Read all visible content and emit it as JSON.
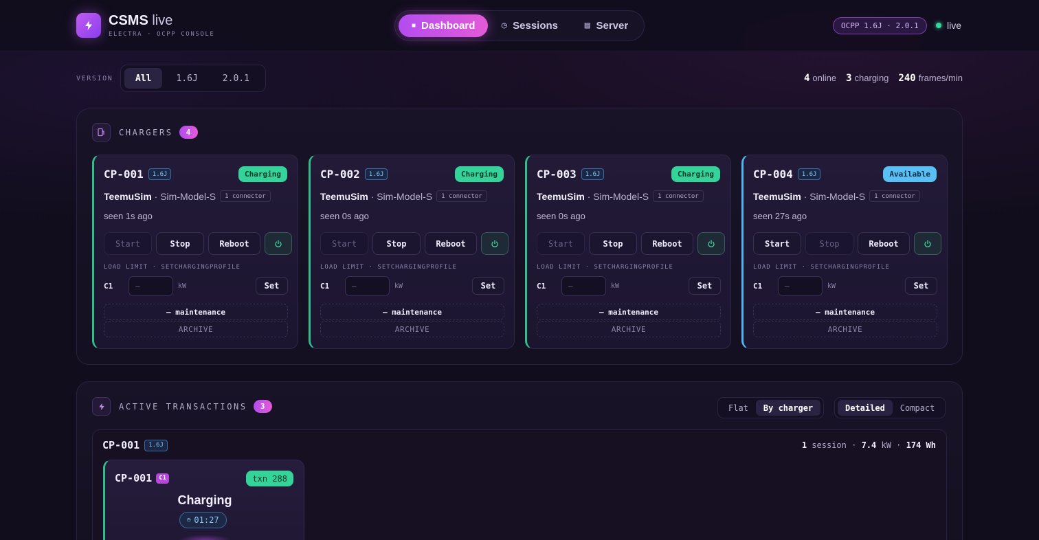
{
  "brand": {
    "title": "CSMS",
    "title_suffix": "live",
    "subtitle": "ELECTRA · OCPP CONSOLE"
  },
  "nav": [
    {
      "label": "Dashboard",
      "icon": "grid-icon",
      "active": true
    },
    {
      "label": "Sessions",
      "icon": "clock-icon",
      "active": false
    },
    {
      "label": "Server",
      "icon": "server-icon",
      "active": false
    }
  ],
  "protocol_badge": "OCPP 1.6J · 2.0.1",
  "live_label": "live",
  "filter": {
    "label": "VERSION",
    "options": [
      "All",
      "1.6J",
      "2.0.1"
    ],
    "selected": "All"
  },
  "stats": [
    {
      "value": "4",
      "label": "online"
    },
    {
      "value": "3",
      "label": "charging"
    },
    {
      "value": "240",
      "label": "frames/min"
    }
  ],
  "chargers_panel": {
    "title": "CHARGERS",
    "count": "4"
  },
  "chargers": [
    {
      "id": "CP-001",
      "version": "1.6J",
      "status": "Charging",
      "vendor": "TeemuSim",
      "model": "Sim-Model-S",
      "connectors": "1 connector",
      "seen": "seen 1s ago",
      "buttons": {
        "start": "Start",
        "stop": "Stop",
        "reboot": "Reboot"
      },
      "start_enabled": false,
      "stop_enabled": true,
      "load_label": "LOAD LIMIT · SETCHARGINGPROFILE",
      "connector": "C1",
      "kw_placeholder": "—",
      "kw_unit": "kW",
      "set": "Set",
      "maintenance": "– maintenance",
      "archive": "ARCHIVE"
    },
    {
      "id": "CP-002",
      "version": "1.6J",
      "status": "Charging",
      "vendor": "TeemuSim",
      "model": "Sim-Model-S",
      "connectors": "1 connector",
      "seen": "seen 0s ago",
      "buttons": {
        "start": "Start",
        "stop": "Stop",
        "reboot": "Reboot"
      },
      "start_enabled": false,
      "stop_enabled": true,
      "load_label": "LOAD LIMIT · SETCHARGINGPROFILE",
      "connector": "C1",
      "kw_placeholder": "—",
      "kw_unit": "kW",
      "set": "Set",
      "maintenance": "– maintenance",
      "archive": "ARCHIVE"
    },
    {
      "id": "CP-003",
      "version": "1.6J",
      "status": "Charging",
      "vendor": "TeemuSim",
      "model": "Sim-Model-S",
      "connectors": "1 connector",
      "seen": "seen 0s ago",
      "buttons": {
        "start": "Start",
        "stop": "Stop",
        "reboot": "Reboot"
      },
      "start_enabled": false,
      "stop_enabled": true,
      "load_label": "LOAD LIMIT · SETCHARGINGPROFILE",
      "connector": "C1",
      "kw_placeholder": "—",
      "kw_unit": "kW",
      "set": "Set",
      "maintenance": "– maintenance",
      "archive": "ARCHIVE"
    },
    {
      "id": "CP-004",
      "version": "1.6J",
      "status": "Available",
      "vendor": "TeemuSim",
      "model": "Sim-Model-S",
      "connectors": "1 connector",
      "seen": "seen 27s ago",
      "buttons": {
        "start": "Start",
        "stop": "Stop",
        "reboot": "Reboot"
      },
      "start_enabled": true,
      "stop_enabled": false,
      "load_label": "LOAD LIMIT · SETCHARGINGPROFILE",
      "connector": "C1",
      "kw_placeholder": "—",
      "kw_unit": "kW",
      "set": "Set",
      "maintenance": "– maintenance",
      "archive": "ARCHIVE"
    }
  ],
  "transactions_panel": {
    "title": "ACTIVE TRANSACTIONS",
    "count": "3",
    "grouping": {
      "options": [
        "Flat",
        "By charger"
      ],
      "selected": "By charger"
    },
    "density": {
      "options": [
        "Detailed",
        "Compact"
      ],
      "selected": "Detailed"
    }
  },
  "tx_group": {
    "charger": "CP-001",
    "version": "1.6J",
    "summary": {
      "sessions": "1",
      "sessions_label": "session",
      "power": "7.4",
      "power_unit": "kW",
      "energy": "174",
      "energy_unit": "Wh"
    }
  },
  "tx_card": {
    "charger": "CP-001",
    "connector": "C1",
    "txn": "txn 288",
    "state": "Charging",
    "timer": "01:27"
  },
  "colors": {
    "accent": "#b44cf0",
    "charging": "#34d399",
    "available": "#58c0f5",
    "background": "#110d1c"
  }
}
